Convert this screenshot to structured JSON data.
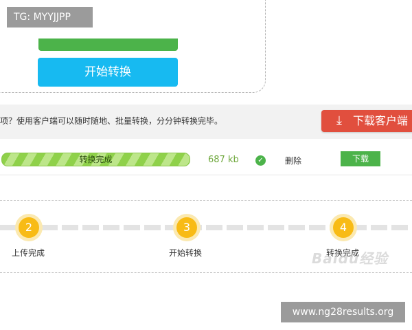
{
  "top_panel": {
    "start_button_label": "开始转换"
  },
  "info_bar": {
    "text": "项？使用客户端可以随时随地、批量转换，分分钟转换完毕。",
    "download_client_label": "下载客户端",
    "download_icon": "download-arrow-icon",
    "accent_color": "#e14f3e"
  },
  "file_row": {
    "progress_label": "转换完成",
    "progress_fraction": 1.0,
    "file_size": "687 kb",
    "status_icon": "check-icon",
    "delete_label": "删除",
    "download_label": "下载"
  },
  "steps": [
    {
      "number": "2",
      "label": "上传完成"
    },
    {
      "number": "3",
      "label": "开始转换"
    },
    {
      "number": "4",
      "label": "转换完成"
    }
  ],
  "overlays": {
    "tg_label": "TG: MYYJJPP",
    "site_label": "www.ng28results.org",
    "watermark": "Baidu经验"
  }
}
